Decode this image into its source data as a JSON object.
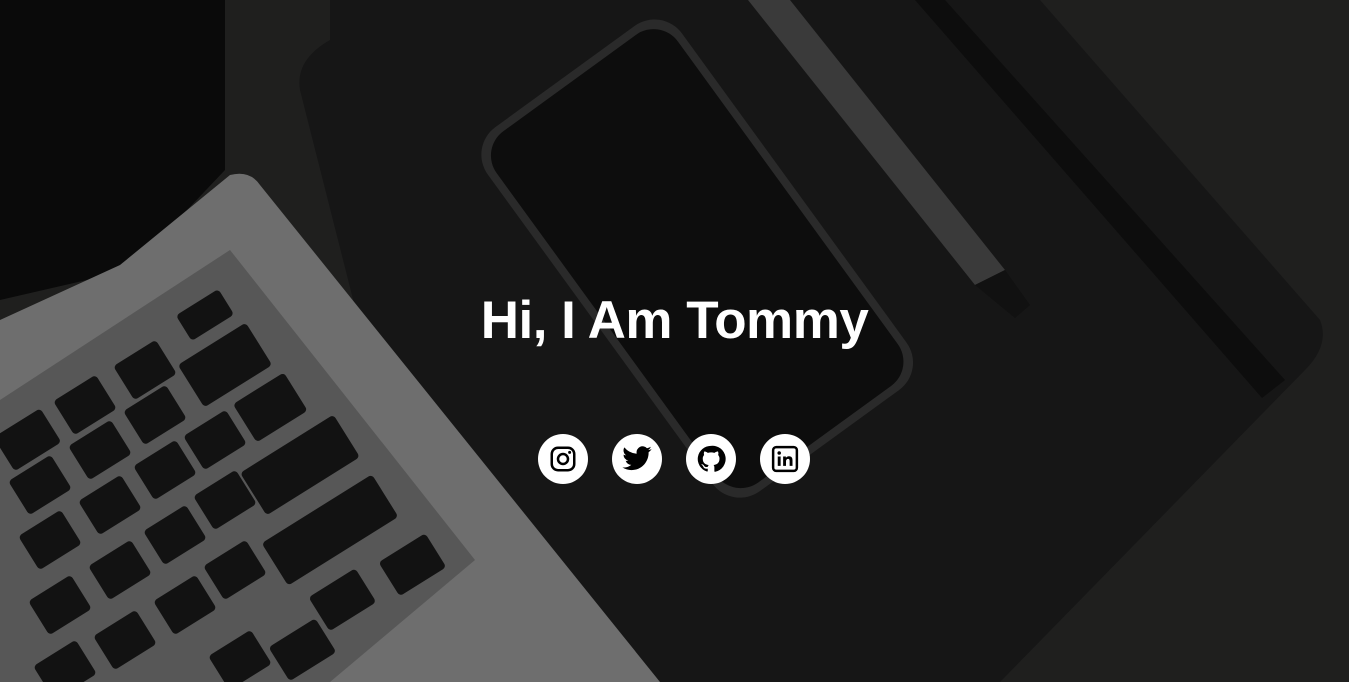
{
  "hero": {
    "title": "Hi, I Am Tommy"
  },
  "social_links": [
    {
      "name": "instagram",
      "icon": "instagram-icon"
    },
    {
      "name": "twitter",
      "icon": "twitter-icon"
    },
    {
      "name": "github",
      "icon": "github-icon"
    },
    {
      "name": "linkedin",
      "icon": "linkedin-icon"
    }
  ],
  "colors": {
    "background": "#1f1f1e",
    "title_text": "#ffffff",
    "icon_circle": "#ffffff",
    "icon_glyph": "#000000"
  }
}
